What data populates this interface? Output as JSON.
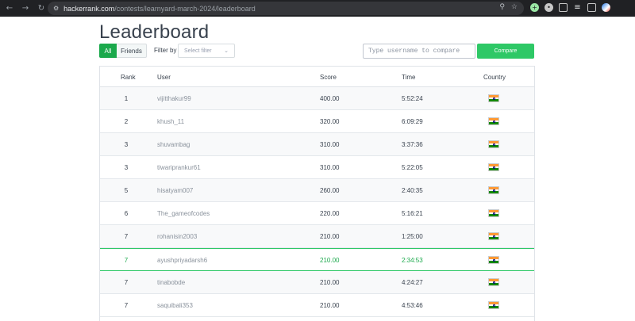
{
  "browser": {
    "url_host": "hackerrank.com",
    "url_path": "/contests/learnyard-march-2024/leaderboard"
  },
  "page": {
    "title": "Leaderboard"
  },
  "filters": {
    "tabs": [
      {
        "label": "All",
        "active": true
      },
      {
        "label": "Friends",
        "active": false
      }
    ],
    "filter_label": "Filter by",
    "filter_placeholder": "Select filter",
    "compare_placeholder": "Type username to compare",
    "compare_button": "Compare"
  },
  "table": {
    "headers": {
      "rank": "Rank",
      "user": "User",
      "score": "Score",
      "time": "Time",
      "country": "Country"
    },
    "rows": [
      {
        "rank": "1",
        "user": "vijitthakur99",
        "score": "400.00",
        "time": "5:52:24",
        "country": "India",
        "highlighted": false
      },
      {
        "rank": "2",
        "user": "khush_11",
        "score": "320.00",
        "time": "6:09:29",
        "country": "India",
        "highlighted": false
      },
      {
        "rank": "3",
        "user": "shuvambag",
        "score": "310.00",
        "time": "3:37:36",
        "country": "India",
        "highlighted": false
      },
      {
        "rank": "3",
        "user": "tiwariprankur61",
        "score": "310.00",
        "time": "5:22:05",
        "country": "India",
        "highlighted": false
      },
      {
        "rank": "5",
        "user": "hisatyam007",
        "score": "260.00",
        "time": "2:40:35",
        "country": "India",
        "highlighted": false
      },
      {
        "rank": "6",
        "user": "The_gameofcodes",
        "score": "220.00",
        "time": "5:16:21",
        "country": "India",
        "highlighted": false
      },
      {
        "rank": "7",
        "user": "rohanisin2003",
        "score": "210.00",
        "time": "1:25:00",
        "country": "India",
        "highlighted": false
      },
      {
        "rank": "7",
        "user": "ayushpriyadarsh6",
        "score": "210.00",
        "time": "2:34:53",
        "country": "India",
        "highlighted": true
      },
      {
        "rank": "7",
        "user": "tinabobde",
        "score": "210.00",
        "time": "4:24:27",
        "country": "India",
        "highlighted": false
      },
      {
        "rank": "7",
        "user": "saquibali353",
        "score": "210.00",
        "time": "4:53:46",
        "country": "India",
        "highlighted": false
      }
    ]
  },
  "colors": {
    "accent_green": "#1ba94c",
    "button_green": "#2ec866",
    "text_dark": "#39424e"
  },
  "icons": [
    "back-arrow-icon",
    "forward-arrow-icon",
    "reload-icon",
    "site-settings-icon",
    "zoom-icon",
    "bookmark-star-icon",
    "india-flag-icon",
    "chevron-down-icon"
  ]
}
